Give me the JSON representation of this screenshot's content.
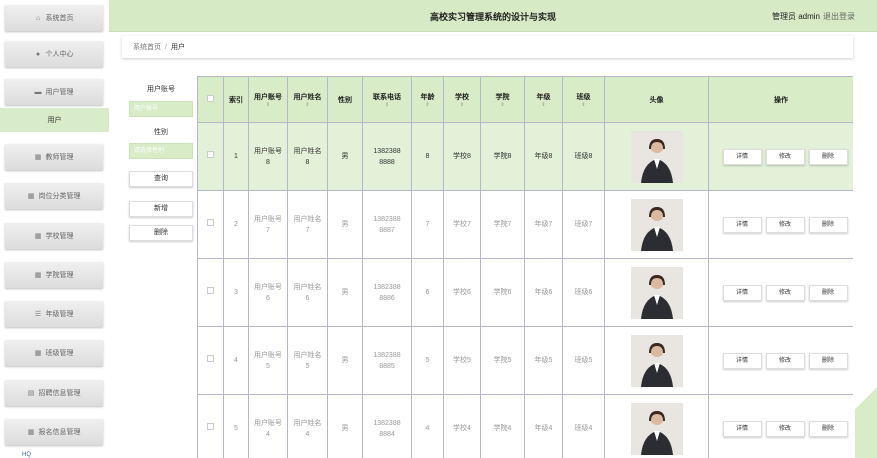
{
  "header": {
    "title": "高校实习管理系统的设计与实现",
    "user": "管理员 admin",
    "logout": "退出登录"
  },
  "sidebar": {
    "items": [
      {
        "label": "系统首页",
        "icon": "home-icon"
      },
      {
        "label": "个人中心",
        "icon": "person-icon"
      },
      {
        "label": "用户管理",
        "icon": "users-icon"
      },
      {
        "label": "用户",
        "icon": ""
      },
      {
        "label": "教师管理",
        "icon": "grid-icon"
      },
      {
        "label": "岗位分类管理",
        "icon": "grid-icon"
      },
      {
        "label": "学校管理",
        "icon": "grid-icon"
      },
      {
        "label": "学院管理",
        "icon": "grid-icon"
      },
      {
        "label": "年级管理",
        "icon": "list-icon"
      },
      {
        "label": "班级管理",
        "icon": "grid-icon"
      },
      {
        "label": "招聘信息管理",
        "icon": "doc-icon"
      },
      {
        "label": "报名信息管理",
        "icon": "grid-icon"
      }
    ]
  },
  "breadcrumb": {
    "home": "系统首页",
    "sep": "/",
    "current": "用户"
  },
  "search": {
    "label_account": "用户账号",
    "input_account_placeholder": "用户账号",
    "label_gender": "性别",
    "select_gender_placeholder": "请选择性别",
    "query": "查询",
    "add": "新增",
    "delete": "删除"
  },
  "table": {
    "headers": [
      "索引",
      "用户账号",
      "用户姓名",
      "性别",
      "联系电话",
      "年龄",
      "学校",
      "学院",
      "年级",
      "班级",
      "头像",
      "操作"
    ],
    "rows": [
      {
        "idx": "1",
        "account": [
          "用户账号",
          "8"
        ],
        "name": [
          "用户姓名",
          "8"
        ],
        "gender": "男",
        "phone": [
          "1382388",
          "8888"
        ],
        "age": "8",
        "school": "学校8",
        "college": "学院8",
        "grade": "年级8",
        "class": "班级8"
      },
      {
        "idx": "2",
        "account": [
          "用户账号",
          "7"
        ],
        "name": [
          "用户姓名",
          "7"
        ],
        "gender": "男",
        "phone": [
          "1382388",
          "8887"
        ],
        "age": "7",
        "school": "学校7",
        "college": "学院7",
        "grade": "年级7",
        "class": "班级7"
      },
      {
        "idx": "3",
        "account": [
          "用户账号",
          "6"
        ],
        "name": [
          "用户姓名",
          "6"
        ],
        "gender": "男",
        "phone": [
          "1382388",
          "8886"
        ],
        "age": "6",
        "school": "学校6",
        "college": "学院6",
        "grade": "年级6",
        "class": "班级6"
      },
      {
        "idx": "4",
        "account": [
          "用户账号",
          "5"
        ],
        "name": [
          "用户姓名",
          "5"
        ],
        "gender": "男",
        "phone": [
          "1382388",
          "8885"
        ],
        "age": "5",
        "school": "学校5",
        "college": "学院5",
        "grade": "年级5",
        "class": "班级5"
      },
      {
        "idx": "5",
        "account": [
          "用户账号",
          "4"
        ],
        "name": [
          "用户姓名",
          "4"
        ],
        "gender": "男",
        "phone": [
          "1382388",
          "8884"
        ],
        "age": "4",
        "school": "学校4",
        "college": "学院4",
        "grade": "年级4",
        "class": "班级4"
      }
    ],
    "actions": {
      "detail": "详情",
      "edit": "修改",
      "delete": "删除"
    }
  },
  "taskbar": {
    "text": "HQ"
  },
  "colors": {
    "accent": "#d7ecc7",
    "grid": "#b7b7cc"
  }
}
